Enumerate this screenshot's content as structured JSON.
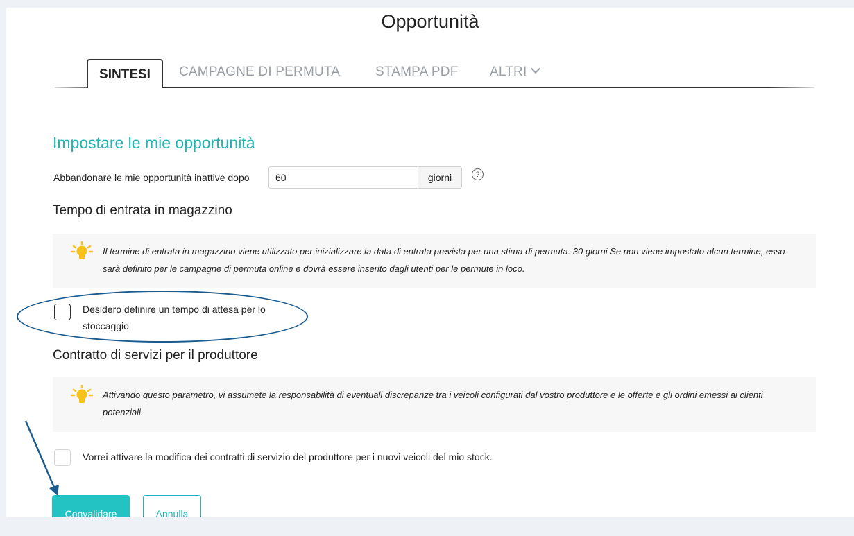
{
  "page": {
    "title": "Opportunità"
  },
  "tabs": {
    "active": "SINTESI",
    "items": [
      "CAMPAGNE DI PERMUTA",
      "STAMPA PDF",
      "ALTRI"
    ]
  },
  "settings": {
    "heading": "Impostare le mie opportunità",
    "abandon_label": "Abbandonare le mie opportunità inattive dopo",
    "abandon_value": "60",
    "abandon_unit": "giorni",
    "help_icon": "?"
  },
  "stock_entry": {
    "heading": "Tempo di entrata in magazzino",
    "info": "Il termine di entrata in magazzino viene utilizzato per inizializzare la data di entrata prevista per una stima di permuta. 30 giorni Se non viene impostato alcun termine, esso sarà definito per le campagne di permuta online e dovrà essere inserito dagli utenti per le permute in loco.",
    "checkbox_label": "Desidero definire un tempo di attesa per lo stoccaggio",
    "checked": false
  },
  "service_contract": {
    "heading": "Contratto di servizi per il produttore",
    "info": "Attivando questo parametro, vi assumete la responsabilità di eventuali discrepanze tra i veicoli configurati dal vostro produttore e le offerte e gli ordini emessi ai clienti potenziali.",
    "checkbox_label": "Vorrei attivare la modifica dei contratti di servizio del produttore per i nuovi veicoli del mio stock.",
    "checked": false
  },
  "actions": {
    "validate": "Convalidare",
    "cancel": "Annulla"
  },
  "colors": {
    "accent": "#24c3c3",
    "annotation": "#1b5b8e",
    "bulb": "#f7c21a"
  },
  "icons": {
    "info": "lightbulb-icon",
    "help": "question-circle-icon",
    "dropdown": "chevron-down-icon"
  }
}
